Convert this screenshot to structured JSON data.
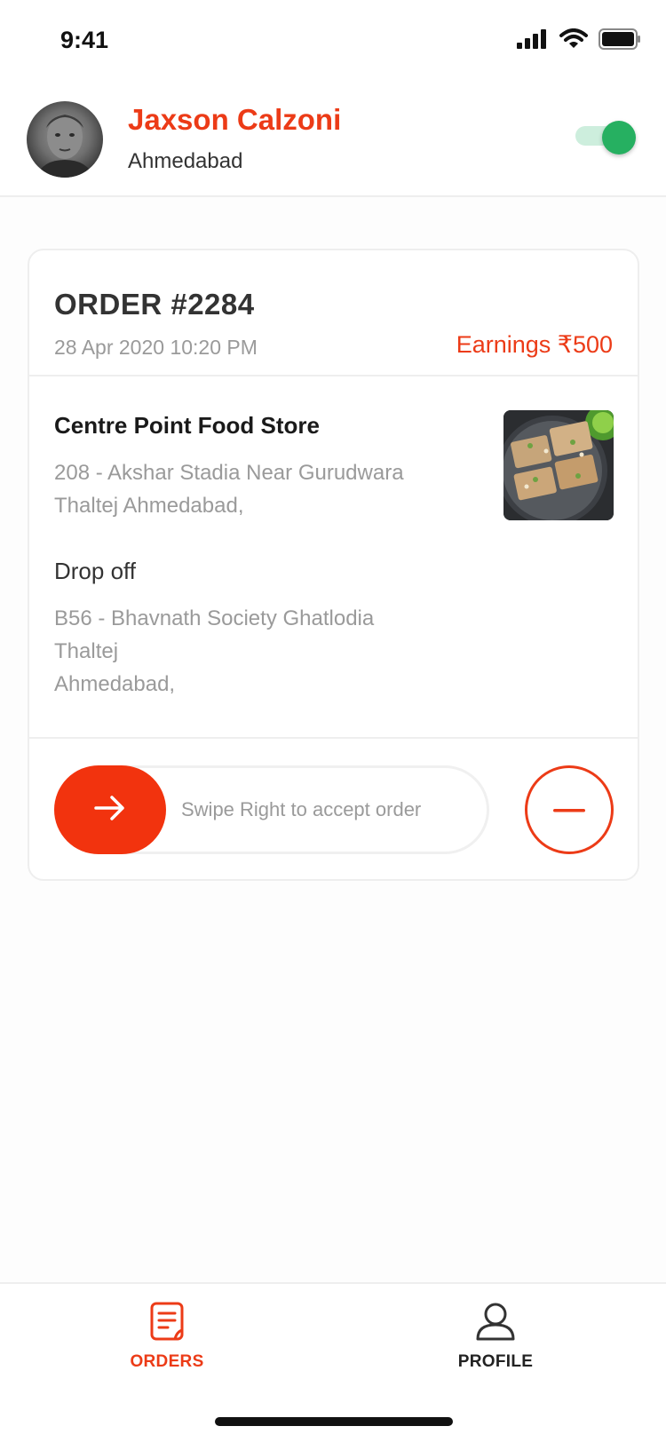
{
  "status_bar": {
    "time": "9:41",
    "icons": [
      "signal-icon",
      "wifi-icon",
      "battery-icon"
    ]
  },
  "header": {
    "name": "Jaxson Calzoni",
    "city": "Ahmedabad",
    "availability_toggle": true
  },
  "order": {
    "number": "ORDER #2284",
    "date": "28 Apr 2020 10:20 PM",
    "earnings": "Earnings ₹500",
    "store_name": "Centre Point Food Store",
    "pickup_address_line1": "208 - Akshar Stadia Near Gurudwara",
    "pickup_address_line2": "Thaltej  Ahmedabad,",
    "dropoff_title": "Drop off",
    "dropoff_address_line1": "B56 - Bhavnath Society Ghatlodia",
    "dropoff_address_line2": "Thaltej",
    "dropoff_address_line3": "Ahmedabad,",
    "swipe_label": "Swipe Right to accept order"
  },
  "nav": {
    "items": [
      {
        "label": "ORDERS",
        "icon": "orders-icon",
        "active": true
      },
      {
        "label": "PROFILE",
        "icon": "profile-icon",
        "active": false
      }
    ]
  },
  "colors": {
    "accent": "#ec3b17",
    "toggle_on": "#26b061",
    "muted_text": "#9a9a9a"
  }
}
